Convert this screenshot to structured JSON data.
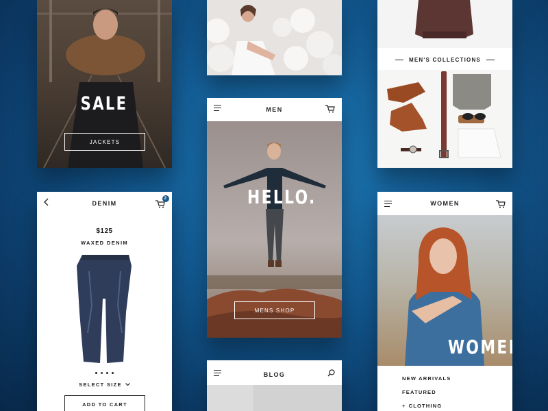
{
  "colors": {
    "accent": "#1a5a8a",
    "background": "#135a92",
    "text": "#222222"
  },
  "sale_card": {
    "headline": "SALE",
    "button_label": "JACKETS"
  },
  "balloons_card": {},
  "collections_card": {
    "section_title": "MEN'S COLLECTIONS"
  },
  "men_card": {
    "nav_title": "MEN",
    "headline": "HELLO.",
    "button_label": "MENS SHOP",
    "menu_icon": "hamburger-icon",
    "cart_icon": "cart-icon"
  },
  "denim_card": {
    "nav_title": "DENIM",
    "cart_badge": "2",
    "price": "$125",
    "product_name": "WAXED DENIM",
    "select_size_label": "SELECT SIZE",
    "add_to_cart_label": "ADD TO CART",
    "carousel_dots": 4,
    "carousel_active": 1
  },
  "blog_card": {
    "nav_title": "BLOG"
  },
  "women_card": {
    "nav_title": "WOMEN",
    "headline": "WOMEN",
    "menu_items": [
      {
        "label": "NEW ARRIVALS"
      },
      {
        "label": "FEATURED"
      },
      {
        "label": "CLOTHING",
        "prefix": "+"
      }
    ]
  }
}
